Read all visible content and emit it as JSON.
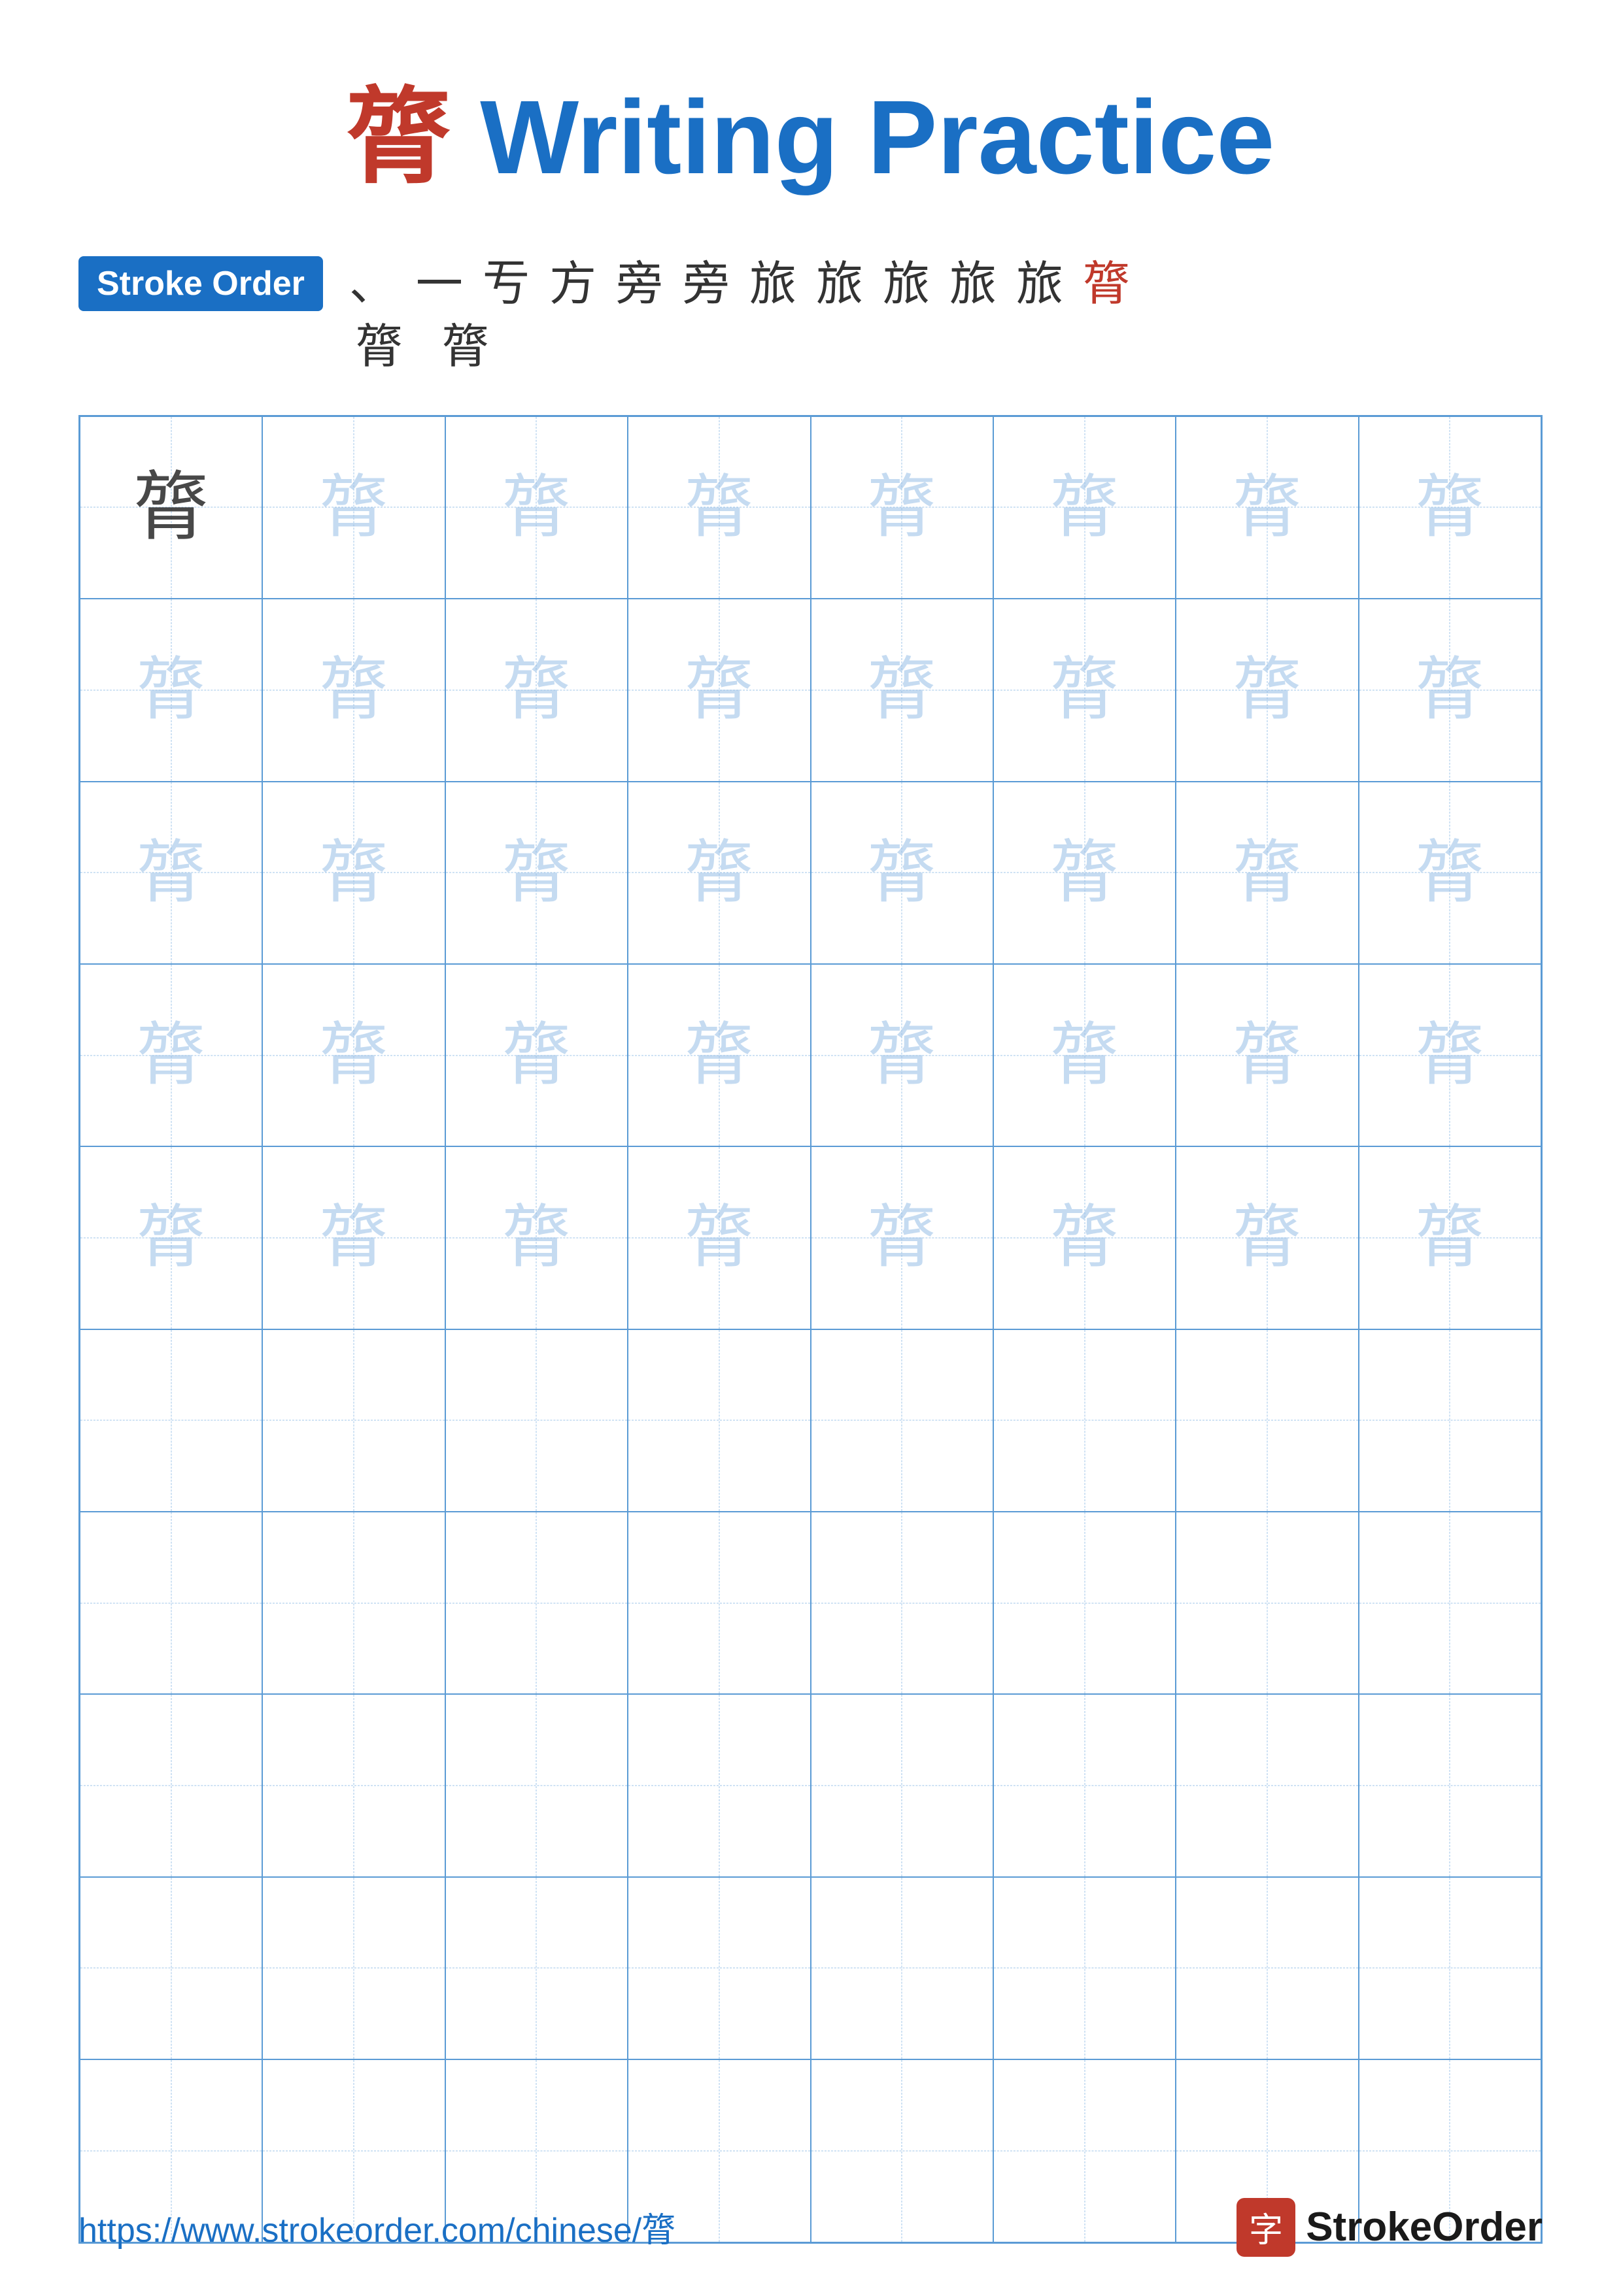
{
  "title": {
    "char": "膂",
    "label": "Writing Practice",
    "full": "膂 Writing Practice"
  },
  "stroke_order": {
    "badge_label": "Stroke Order",
    "strokes": [
      "、",
      "一",
      "亐",
      "方",
      "旁",
      "旁",
      "旅",
      "旅",
      "旅",
      "旅",
      "旅",
      "膂"
    ],
    "row2": [
      "膂",
      "膂"
    ],
    "last_index": 11
  },
  "practice_char": "膂",
  "grid": {
    "cols": 8,
    "practice_rows": 5,
    "empty_rows": 5
  },
  "footer": {
    "url": "https://www.strokeorder.com/chinese/膂",
    "logo_char": "字",
    "logo_text": "StrokeOrder"
  }
}
